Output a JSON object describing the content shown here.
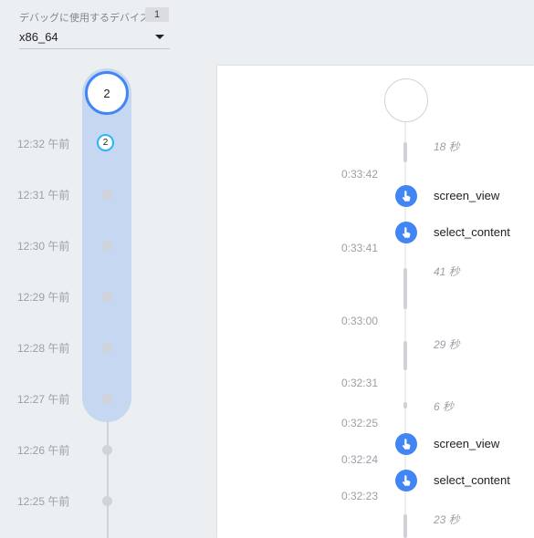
{
  "device_selector": {
    "label": "デバッグに使用するデバイス",
    "count": "1",
    "value": "x86_64"
  },
  "minute_timeline": {
    "top_bubble_count": "2",
    "active_count": "2",
    "minutes": [
      "12:32 午前",
      "12:31 午前",
      "12:30 午前",
      "12:29 午前",
      "12:28 午前",
      "12:27 午前",
      "12:26 午前",
      "12:25 午前"
    ]
  },
  "stream": {
    "durations": [
      "18 秒",
      "41 秒",
      "29 秒",
      "6 秒",
      "23 秒"
    ],
    "timestamps": [
      "0:33:42",
      "0:33:41",
      "0:33:00",
      "0:32:31",
      "0:32:25",
      "0:32:24",
      "0:32:23"
    ],
    "events": [
      {
        "name": "screen_view",
        "icon": "touch-icon"
      },
      {
        "name": "select_content",
        "icon": "touch-icon"
      },
      {
        "name": "screen_view",
        "icon": "touch-icon"
      },
      {
        "name": "select_content",
        "icon": "touch-icon"
      }
    ]
  },
  "colors": {
    "accent": "#4285f4",
    "active_ring": "#29b6f6",
    "highlight": "#c6d8f1"
  }
}
